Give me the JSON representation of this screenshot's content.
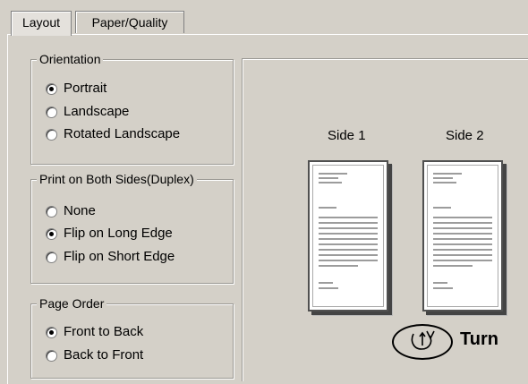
{
  "tabs": [
    {
      "label": "Layout",
      "active": true
    },
    {
      "label": "Paper/Quality",
      "active": false
    }
  ],
  "orientation": {
    "title": "Orientation",
    "options": [
      {
        "label": "Portrait",
        "checked": true
      },
      {
        "label": "Landscape",
        "checked": false
      },
      {
        "label": "Rotated Landscape",
        "checked": false
      }
    ]
  },
  "duplex": {
    "title": "Print on Both Sides(Duplex)",
    "options": [
      {
        "label": "None",
        "checked": false
      },
      {
        "label": "Flip on Long Edge",
        "checked": true
      },
      {
        "label": "Flip on Short Edge",
        "checked": false
      }
    ]
  },
  "page_order": {
    "title": "Page Order",
    "options": [
      {
        "label": "Front to Back",
        "checked": true
      },
      {
        "label": "Back to Front",
        "checked": false
      }
    ]
  },
  "preview": {
    "side1_label": "Side 1",
    "side2_label": "Side 2",
    "turn_label": "Turn",
    "turn_icon": "turn-arrow-icon"
  },
  "colors": {
    "dialog_background": "#d4d0c8",
    "border_shadow": "#808080"
  }
}
